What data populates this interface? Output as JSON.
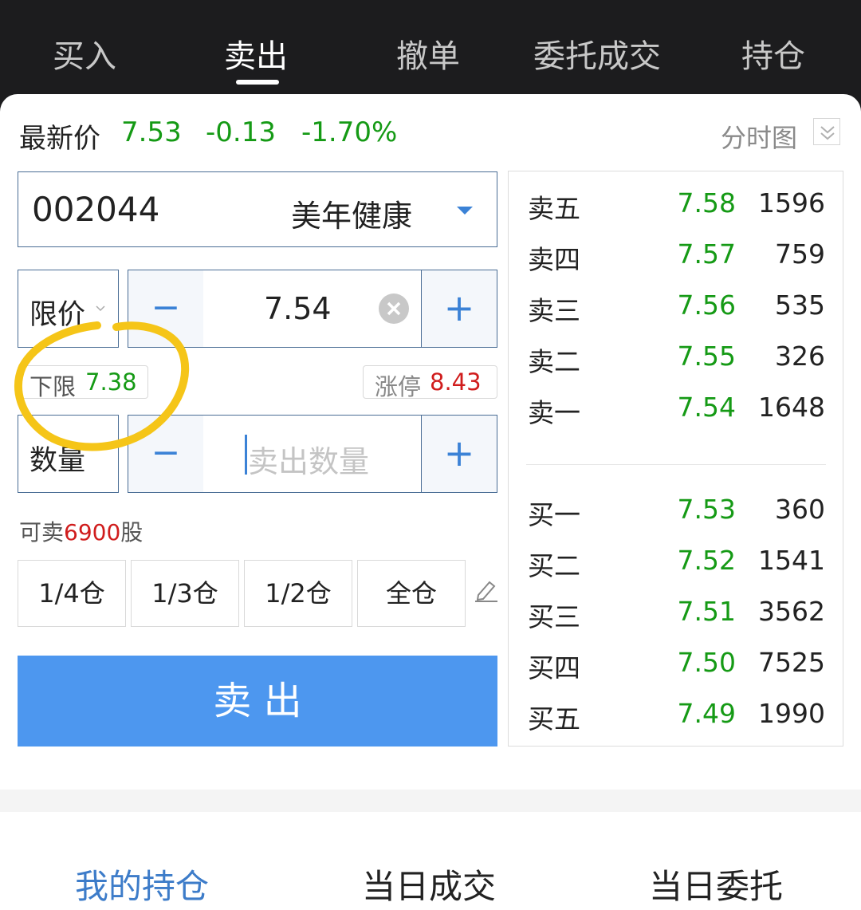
{
  "tabs": [
    {
      "label": "买入"
    },
    {
      "label": "卖出"
    },
    {
      "label": "撤单"
    },
    {
      "label": "委托成交"
    },
    {
      "label": "持仓"
    }
  ],
  "quote": {
    "label": "最新价",
    "price": "7.53",
    "change": "-0.13",
    "change_pct": "-1.70%",
    "chart_link": "分时图"
  },
  "stock": {
    "code": "002044",
    "name": "美年健康"
  },
  "order": {
    "type_label": "限价",
    "price_value": "7.54",
    "lower_limit_label": "下限",
    "lower_limit_value": "7.38",
    "upper_limit_label": "涨停",
    "upper_limit_value": "8.43",
    "qty_label": "数量",
    "qty_placeholder": "卖出数量",
    "available_prefix": "可卖",
    "available_qty": "6900",
    "available_unit": "股",
    "minus": "−",
    "plus": "+"
  },
  "position_buttons": [
    {
      "label": "1/4仓"
    },
    {
      "label": "1/3仓"
    },
    {
      "label": "1/2仓"
    },
    {
      "label": "全仓"
    }
  ],
  "submit_label": "卖 出",
  "order_book": {
    "asks": [
      {
        "label": "卖五",
        "price": "7.58",
        "volume": "1596"
      },
      {
        "label": "卖四",
        "price": "7.57",
        "volume": "759"
      },
      {
        "label": "卖三",
        "price": "7.56",
        "volume": "535"
      },
      {
        "label": "卖二",
        "price": "7.55",
        "volume": "326"
      },
      {
        "label": "卖一",
        "price": "7.54",
        "volume": "1648"
      }
    ],
    "bids": [
      {
        "label": "买一",
        "price": "7.53",
        "volume": "360"
      },
      {
        "label": "买二",
        "price": "7.52",
        "volume": "1541"
      },
      {
        "label": "买三",
        "price": "7.51",
        "volume": "3562"
      },
      {
        "label": "买四",
        "price": "7.50",
        "volume": "7525"
      },
      {
        "label": "买五",
        "price": "7.49",
        "volume": "1990"
      }
    ]
  },
  "bottom_tabs": [
    {
      "label": "我的持仓"
    },
    {
      "label": "当日成交"
    },
    {
      "label": "当日委托"
    }
  ],
  "colors": {
    "accent": "#4d97ef",
    "up": "#d01c1c",
    "down": "#159a15",
    "highlight": "#f5c518"
  },
  "icons": [
    "chevron-down-icon",
    "dropdown-triangle-icon",
    "clear-icon",
    "edit-icon"
  ]
}
